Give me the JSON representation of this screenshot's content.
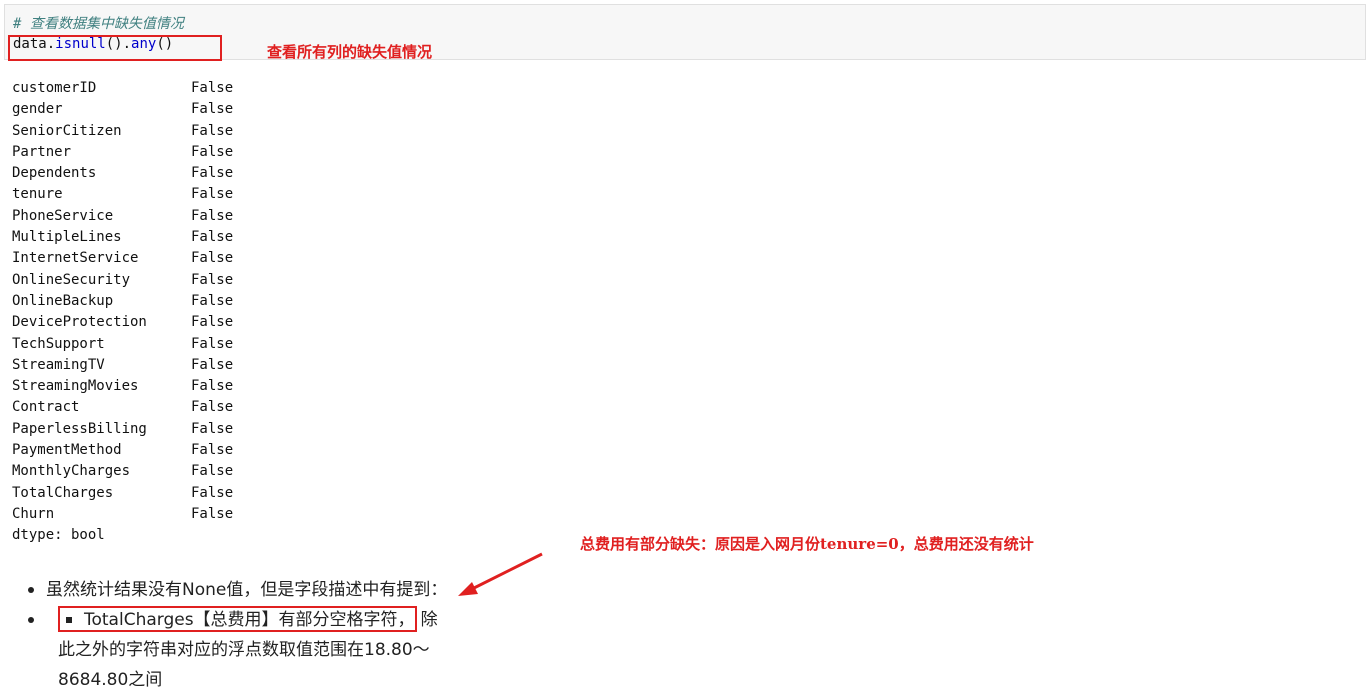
{
  "code_cell": {
    "comment": "# 查看数据集中缺失值情况",
    "code_prefix": "data.",
    "code_fn1": "isnull",
    "code_mid": "().",
    "code_fn2": "any",
    "code_suffix": "()"
  },
  "annotation_top": "查看所有列的缺失值情况",
  "output": {
    "rows": [
      {
        "col": "customerID",
        "val": "False"
      },
      {
        "col": "gender",
        "val": "False"
      },
      {
        "col": "SeniorCitizen",
        "val": "False"
      },
      {
        "col": "Partner",
        "val": "False"
      },
      {
        "col": "Dependents",
        "val": "False"
      },
      {
        "col": "tenure",
        "val": "False"
      },
      {
        "col": "PhoneService",
        "val": "False"
      },
      {
        "col": "MultipleLines",
        "val": "False"
      },
      {
        "col": "InternetService",
        "val": "False"
      },
      {
        "col": "OnlineSecurity",
        "val": "False"
      },
      {
        "col": "OnlineBackup",
        "val": "False"
      },
      {
        "col": "DeviceProtection",
        "val": "False"
      },
      {
        "col": "TechSupport",
        "val": "False"
      },
      {
        "col": "StreamingTV",
        "val": "False"
      },
      {
        "col": "StreamingMovies",
        "val": "False"
      },
      {
        "col": "Contract",
        "val": "False"
      },
      {
        "col": "PaperlessBilling",
        "val": "False"
      },
      {
        "col": "PaymentMethod",
        "val": "False"
      },
      {
        "col": "MonthlyCharges",
        "val": "False"
      },
      {
        "col": "TotalCharges",
        "val": "False"
      },
      {
        "col": "Churn",
        "val": "False"
      }
    ],
    "dtype": "dtype: bool"
  },
  "annotation_bottom": "总费用有部分缺失：原因是入网月份tenure=0，总费用还没有统计",
  "markdown": {
    "item1": "虽然统计结果没有None值，但是字段描述中有提到：",
    "item2_boxed": "TotalCharges【总费用】有部分空格字符，",
    "item2_rest": "除此之外的字符串对应的浮点数取值范围在18.80～8684.80之间"
  },
  "colors": {
    "annotation_red": "#e02020",
    "code_bg": "#f7f7f7",
    "comment": "#408080"
  }
}
